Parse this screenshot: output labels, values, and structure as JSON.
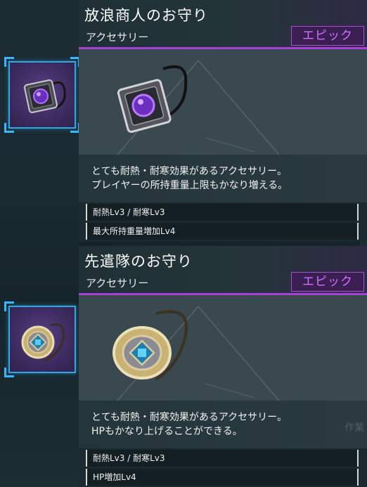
{
  "items": [
    {
      "name": "放浪商人のお守り",
      "category": "アクセサリー",
      "rarity": "エピック",
      "description_lines": [
        "とても耐熱・耐寒効果があるアクセサリー。",
        "プレイヤーの所持重量上限もかなり増える。"
      ],
      "stats": [
        "耐熱Lv3 / 耐寒Lv3",
        "最大所持重量増加Lv4"
      ],
      "icon": "purple-gem-amulet-icon"
    },
    {
      "name": "先遣隊のお守り",
      "category": "アクセサリー",
      "rarity": "エピック",
      "description_lines": [
        "とても耐熱・耐寒効果があるアクセサリー。",
        "HPもかなり上げることができる。"
      ],
      "stats": [
        "耐熱Lv3 / 耐寒Lv3",
        "HP増加Lv4"
      ],
      "icon": "gold-blue-gem-amulet-icon"
    }
  ],
  "background_text": "作業",
  "colors": {
    "rarity_epic": "#d070ff",
    "slot_border": "#2fa8e8",
    "accent_line": "#a640d8"
  }
}
